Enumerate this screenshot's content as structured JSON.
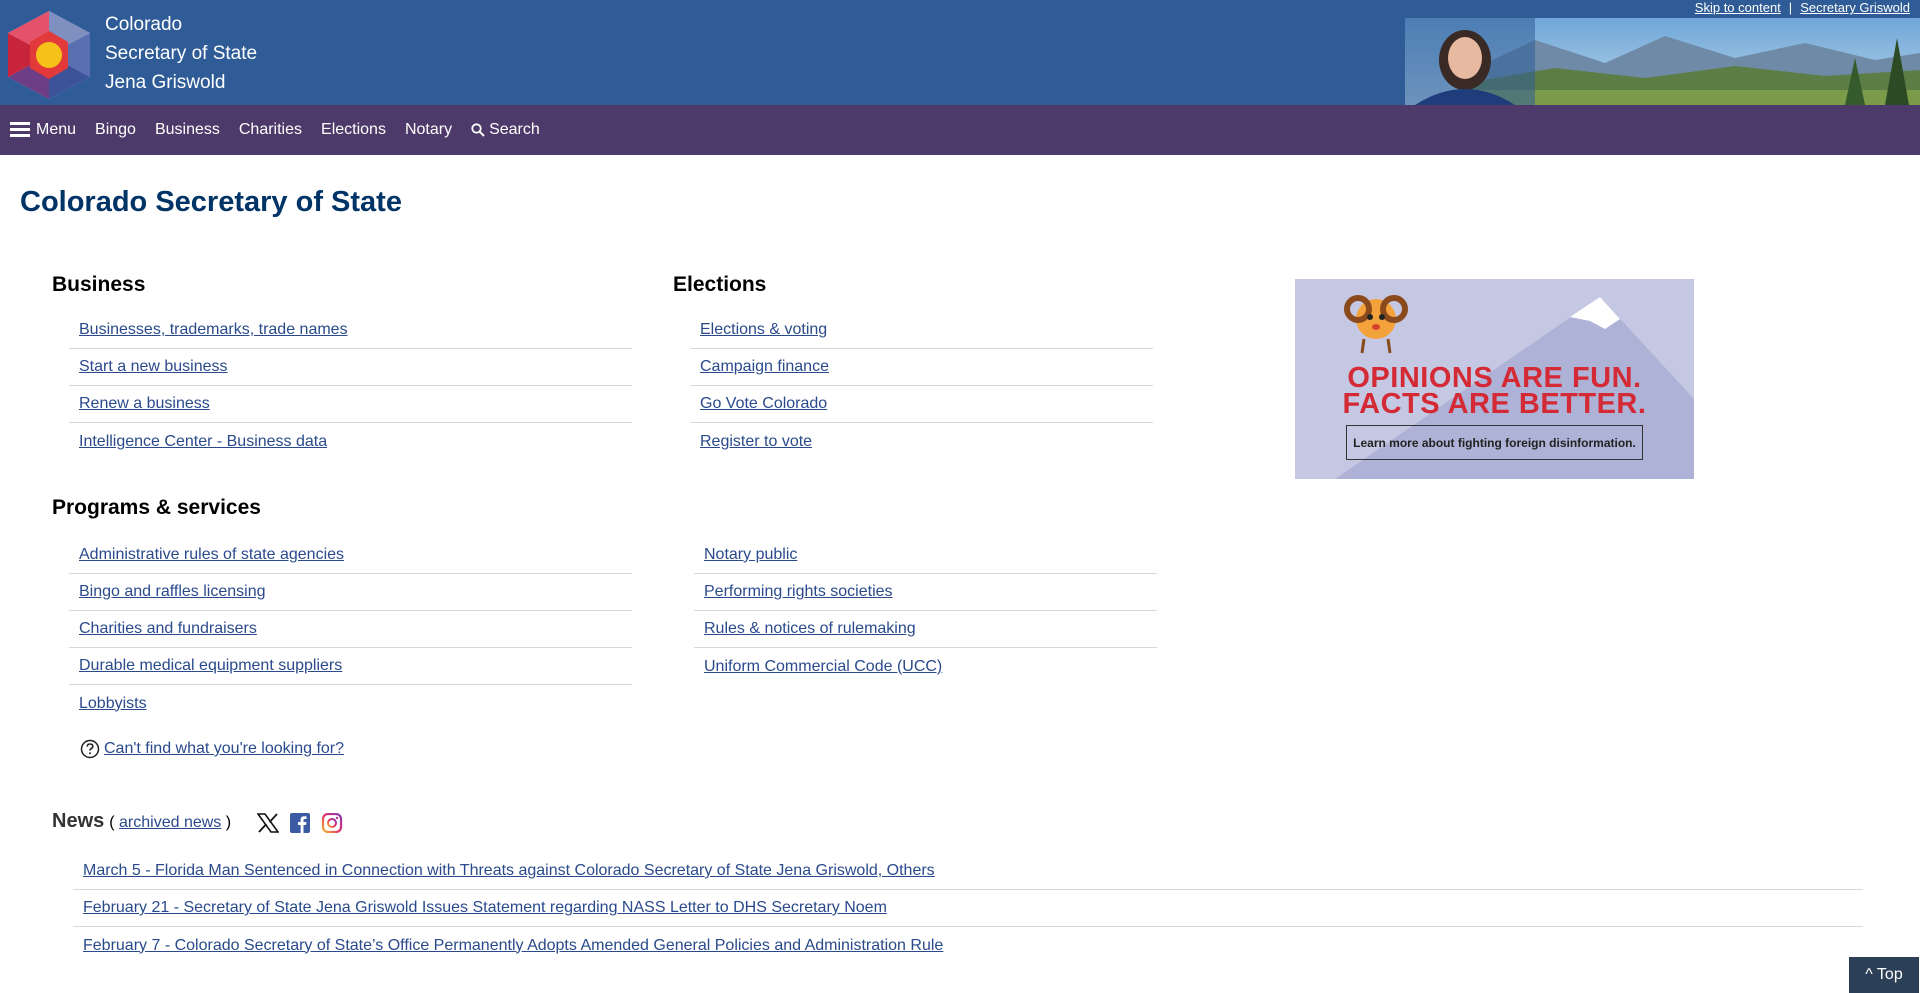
{
  "header": {
    "title_line1": "Colorado",
    "title_line2": "Secretary of State",
    "title_line3": "Jena Griswold",
    "skip_link": "Skip to content",
    "separator": "|",
    "secretary_link": "Secretary Griswold"
  },
  "nav": {
    "items": [
      {
        "label": "Menu",
        "icon": "hamburger-menu-icon"
      },
      {
        "label": "Bingo"
      },
      {
        "label": "Business"
      },
      {
        "label": "Charities"
      },
      {
        "label": "Elections"
      },
      {
        "label": "Notary"
      },
      {
        "label": "Search",
        "icon": "search-icon"
      }
    ]
  },
  "page_title": "Colorado Secretary of State",
  "business": {
    "heading": "Business",
    "links": [
      "Businesses, trademarks, trade names",
      "Start a new business",
      "Renew a business",
      "Intelligence Center - Business data"
    ]
  },
  "elections": {
    "heading": "Elections",
    "links": [
      "Elections & voting",
      "Campaign finance",
      "Go Vote Colorado",
      "Register to vote"
    ]
  },
  "promo": {
    "line1": "OPINIONS ARE FUN.",
    "line2": "FACTS ARE BETTER.",
    "button": "Learn more about fighting foreign disinformation.",
    "accent": "#d42a35",
    "background": "#c5c8e3"
  },
  "programs": {
    "heading": "Programs & services",
    "left_links": [
      "Administrative rules of state agencies",
      "Bingo and raffles licensing",
      "Charities and fundraisers",
      "Durable medical equipment suppliers",
      "Lobbyists"
    ],
    "right_links": [
      "Notary public",
      "Performing rights societies",
      "Rules & notices of rulemaking",
      "Uniform Commercial Code (UCC)"
    ]
  },
  "help": {
    "label": "Can't find what you're looking for?",
    "icon": "question-circle-icon"
  },
  "news": {
    "heading": "News",
    "open_paren": "(",
    "archive_link": "archived news",
    "close_paren": ")",
    "socials": [
      "x-twitter-icon",
      "facebook-icon",
      "instagram-icon"
    ],
    "items": [
      "March 5 - Florida Man Sentenced in Connection with Threats against Colorado Secretary of State Jena Griswold, Others",
      "February 21 - Secretary of State Jena Griswold Issues Statement regarding NASS Letter to DHS Secretary Noem",
      "February 7 - Colorado Secretary of State’s Office Permanently Adopts Amended General Policies and Administration Rule"
    ]
  },
  "back_to_top": "^ Top",
  "colors": {
    "banner": "#2f5c97",
    "nav": "#4e3a6a",
    "title": "#003366",
    "link": "#2a4a8c"
  }
}
